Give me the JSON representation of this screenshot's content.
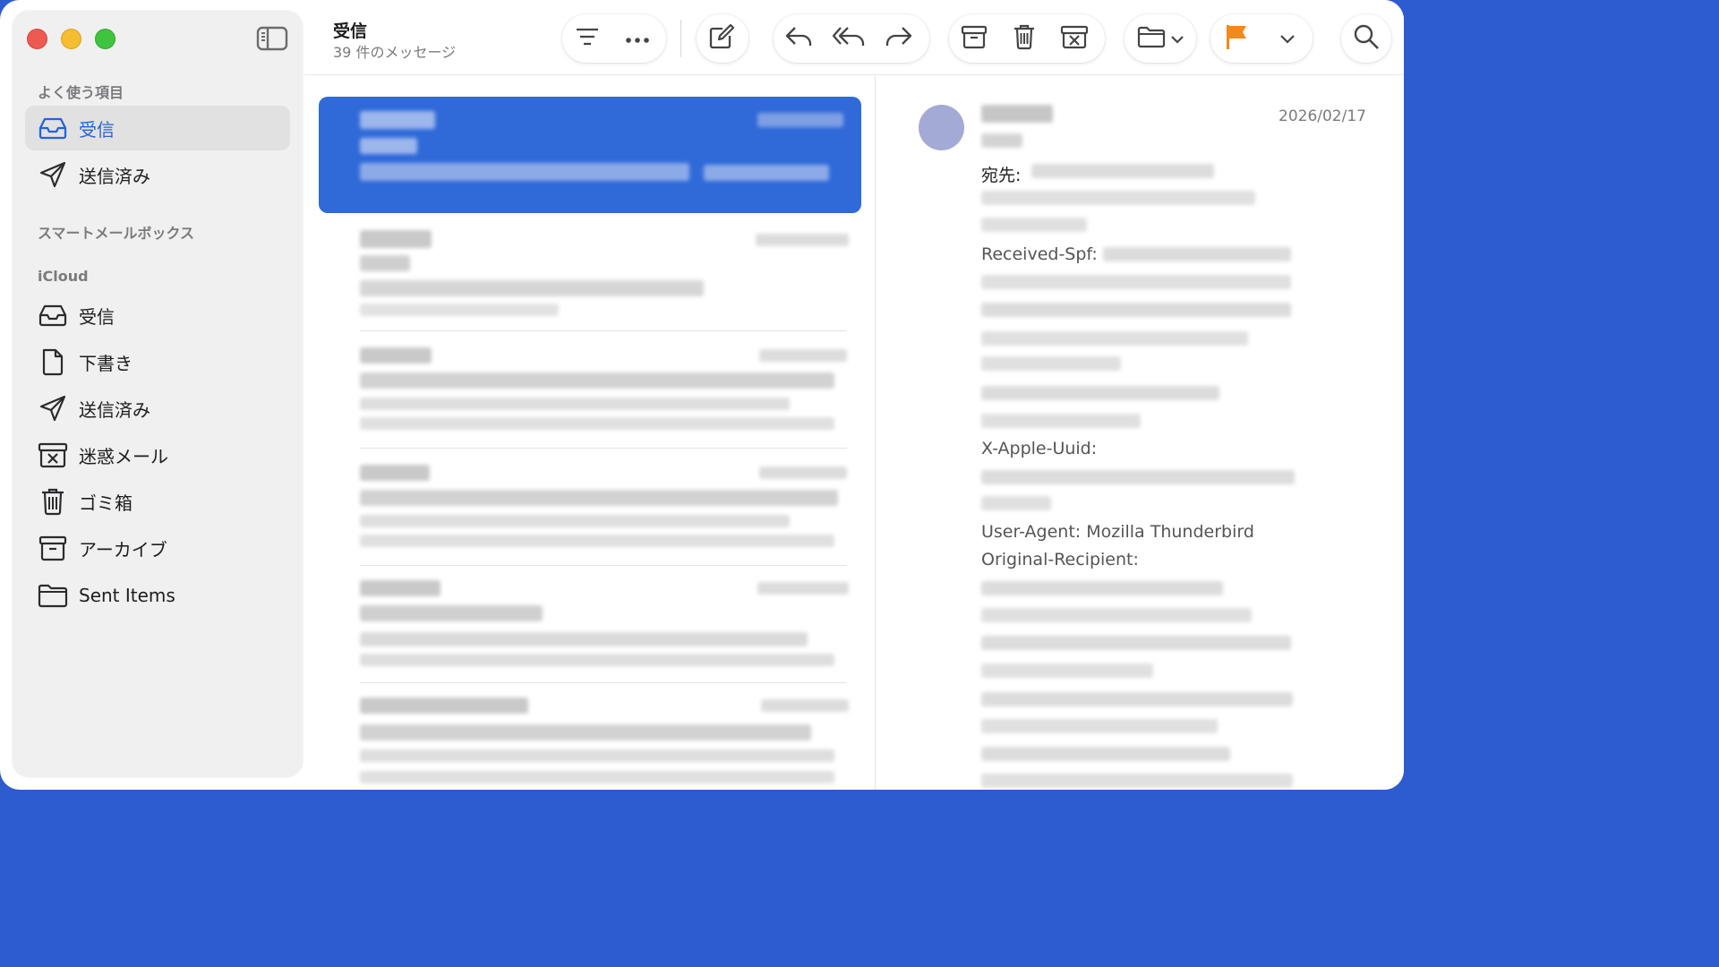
{
  "sidebar": {
    "favorites_label": "よく使う項目",
    "favorites": [
      {
        "label": "受信",
        "icon": "inbox-icon",
        "active": true
      },
      {
        "label": "送信済み",
        "icon": "paper-plane-icon",
        "active": false
      }
    ],
    "smart_label": "スマートメールボックス",
    "icloud_label": "iCloud",
    "icloud": [
      {
        "label": "受信",
        "icon": "inbox-icon"
      },
      {
        "label": "下書き",
        "icon": "document-icon"
      },
      {
        "label": "送信済み",
        "icon": "paper-plane-icon"
      },
      {
        "label": "迷惑メール",
        "icon": "junk-icon"
      },
      {
        "label": "ゴミ箱",
        "icon": "trash-icon"
      },
      {
        "label": "アーカイブ",
        "icon": "archive-icon"
      },
      {
        "label": "Sent Items",
        "icon": "folder-icon"
      }
    ]
  },
  "toolbar": {
    "title": "受信",
    "subtitle": "39 件のメッセージ"
  },
  "reader": {
    "date": "2026/02/17",
    "to_label": "宛先:",
    "received_spf_label": "Received-Spf:",
    "x_apple_uuid_label": "X-Apple-Uuid:",
    "user_agent": "User-Agent: Mozilla Thunderbird",
    "original_recipient_label": "Original-Recipient:"
  },
  "colors": {
    "accent": "#2563d8",
    "selected_row": "#2f6ad8",
    "flag": "#f08a1d",
    "avatar": "#a3aad6"
  }
}
